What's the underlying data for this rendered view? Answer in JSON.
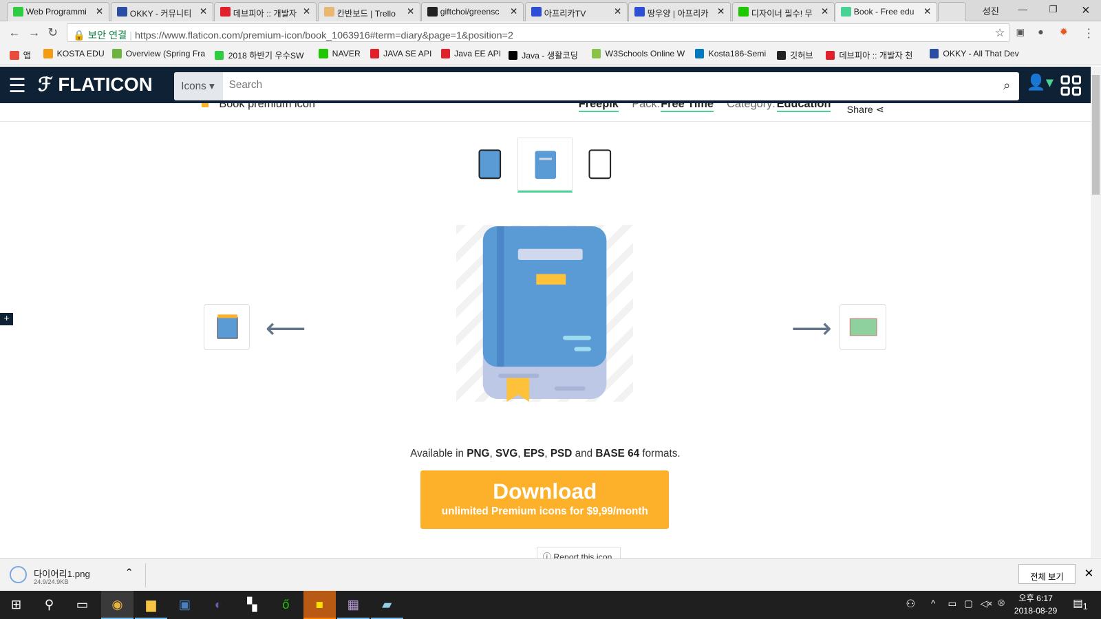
{
  "browser": {
    "tabs": [
      {
        "label": "Web Programmi",
        "color": "#2ecc40"
      },
      {
        "label": "OKKY - 커뮤니티",
        "color": "#2b4ea2"
      },
      {
        "label": "데브피아 :: 개발자",
        "color": "#e0202a"
      },
      {
        "label": "칸반보드 | Trello",
        "color": "#e8b872"
      },
      {
        "label": "giftchoi/greensc",
        "color": "#222222"
      },
      {
        "label": "아프리카TV",
        "color": "#2c4fd6"
      },
      {
        "label": "땅우양 | 아프리카",
        "color": "#2c4fd6"
      },
      {
        "label": "디자이너 필수! 무",
        "color": "#1ec800"
      },
      {
        "label": "Book - Free edu",
        "color": "#4ad295",
        "active": true
      }
    ],
    "profile": "성진",
    "secure_label": "보안 연결",
    "url": "https://www.flaticon.com/premium-icon/book_1063916#term=diary&page=1&position=2",
    "bookmarks": [
      {
        "label": "앱",
        "color": "#e74c3c"
      },
      {
        "label": "KOSTA EDU",
        "color": "#f39c12"
      },
      {
        "label": "Overview (Spring Fra",
        "color": "#6db33f"
      },
      {
        "label": "2018 하반기 우수SW",
        "color": "#2ecc40"
      },
      {
        "label": "NAVER",
        "color": "#1ec800"
      },
      {
        "label": "JAVA SE API",
        "color": "#e0202a"
      },
      {
        "label": "Java EE API",
        "color": "#e0202a"
      },
      {
        "label": "Java - 생활코딩",
        "color": "#000000"
      },
      {
        "label": "W3Schools Online W",
        "color": "#8bc34a"
      },
      {
        "label": "Kosta186-Semi",
        "color": "#0079bf"
      },
      {
        "label": "깃허브",
        "color": "#222222"
      },
      {
        "label": "데브피아 :: 개발자 천",
        "color": "#e0202a"
      },
      {
        "label": "OKKY - All That Dev",
        "color": "#2b4ea2"
      }
    ]
  },
  "site": {
    "brand": "FLATICON",
    "search_type": "Icons",
    "search_placeholder": "Search",
    "title": "Book premium icon",
    "author": "Freepik",
    "pack_label": "Pack:",
    "pack": "Free Time",
    "category_label": "Category:",
    "category": "Education",
    "share": "Share",
    "avail_prefix": "Available in",
    "formats": [
      "PNG",
      "SVG",
      "EPS",
      "PSD"
    ],
    "avail_and": "and",
    "format_last": "BASE 64",
    "avail_suffix": "formats.",
    "download": "Download",
    "download_sub": "unlimited Premium icons for $9,99/month",
    "report": "Report this icon",
    "accent": "#4ad295",
    "download_color": "#fdb12b"
  },
  "download_bar": {
    "file": "다이어리1.png",
    "size": "24.9/24.9KB",
    "show_all": "전체 보기"
  },
  "taskbar": {
    "time": "오후 6:17",
    "date": "2018-08-29",
    "notifications": "1"
  }
}
